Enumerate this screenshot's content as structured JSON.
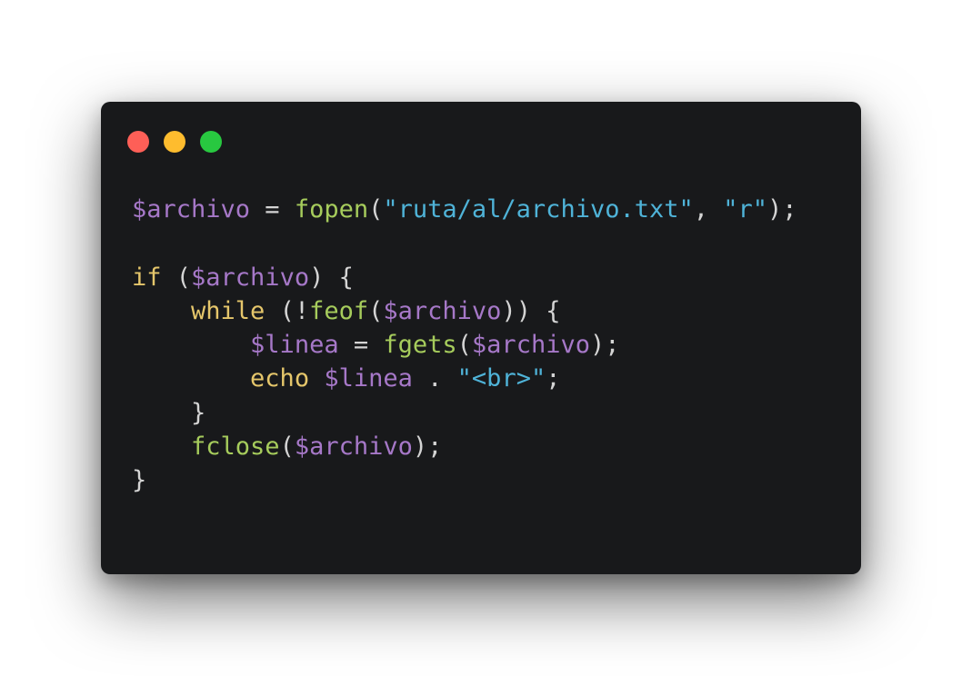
{
  "window": {
    "background": "#18191b",
    "traffic_lights": [
      {
        "name": "close-button",
        "color": "#fe5f57"
      },
      {
        "name": "minimize-button",
        "color": "#febc2e"
      },
      {
        "name": "maximize-button",
        "color": "#28c840"
      }
    ]
  },
  "colors": {
    "variable": "#a678c8",
    "function": "#a6cc5c",
    "keyword": "#e5c66b",
    "string": "#4fb3d8",
    "punctuation": "#d4d4d4"
  },
  "code": {
    "language": "php",
    "lines": [
      [
        {
          "t": "$archivo",
          "c": "variable"
        },
        {
          "t": " = ",
          "c": "punctuation"
        },
        {
          "t": "fopen",
          "c": "function"
        },
        {
          "t": "(",
          "c": "punctuation"
        },
        {
          "t": "\"ruta/al/archivo.txt\"",
          "c": "string"
        },
        {
          "t": ", ",
          "c": "punctuation"
        },
        {
          "t": "\"r\"",
          "c": "string"
        },
        {
          "t": ");",
          "c": "punctuation"
        }
      ],
      [],
      [
        {
          "t": "if",
          "c": "keyword"
        },
        {
          "t": " (",
          "c": "punctuation"
        },
        {
          "t": "$archivo",
          "c": "variable"
        },
        {
          "t": ") {",
          "c": "punctuation"
        }
      ],
      [
        {
          "t": "    ",
          "c": "punctuation"
        },
        {
          "t": "while",
          "c": "keyword"
        },
        {
          "t": " (!",
          "c": "punctuation"
        },
        {
          "t": "feof",
          "c": "function"
        },
        {
          "t": "(",
          "c": "punctuation"
        },
        {
          "t": "$archivo",
          "c": "variable"
        },
        {
          "t": ")) {",
          "c": "punctuation"
        }
      ],
      [
        {
          "t": "        ",
          "c": "punctuation"
        },
        {
          "t": "$linea",
          "c": "variable"
        },
        {
          "t": " = ",
          "c": "punctuation"
        },
        {
          "t": "fgets",
          "c": "function"
        },
        {
          "t": "(",
          "c": "punctuation"
        },
        {
          "t": "$archivo",
          "c": "variable"
        },
        {
          "t": ");",
          "c": "punctuation"
        }
      ],
      [
        {
          "t": "        ",
          "c": "punctuation"
        },
        {
          "t": "echo",
          "c": "keyword"
        },
        {
          "t": " ",
          "c": "punctuation"
        },
        {
          "t": "$linea",
          "c": "variable"
        },
        {
          "t": " . ",
          "c": "punctuation"
        },
        {
          "t": "\"<br>\"",
          "c": "string"
        },
        {
          "t": ";",
          "c": "punctuation"
        }
      ],
      [
        {
          "t": "    }",
          "c": "punctuation"
        }
      ],
      [
        {
          "t": "    ",
          "c": "punctuation"
        },
        {
          "t": "fclose",
          "c": "function"
        },
        {
          "t": "(",
          "c": "punctuation"
        },
        {
          "t": "$archivo",
          "c": "variable"
        },
        {
          "t": ");",
          "c": "punctuation"
        }
      ],
      [
        {
          "t": "}",
          "c": "punctuation"
        }
      ]
    ]
  }
}
